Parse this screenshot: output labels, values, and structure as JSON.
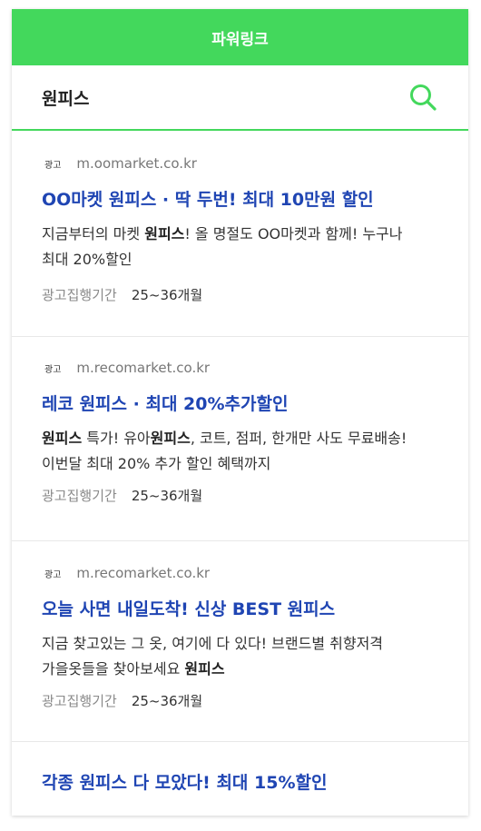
{
  "header": {
    "title": "파워링크"
  },
  "search": {
    "query": "원피스"
  },
  "ads": [
    {
      "badge": "광고",
      "url": "m.oomarket.co.kr",
      "title": "OO마켓 원피스 · 딱 두번! 최대 10만원 할인",
      "desc": [
        {
          "t": "지금부터의 마켓 ",
          "b": false
        },
        {
          "t": "원피스",
          "b": true
        },
        {
          "t": "! 올 명절도 OO마켓과 함께! 누구나 최대 20%할인",
          "b": false
        }
      ],
      "period_label": "광고집행기간",
      "period_value": "25~36개월"
    },
    {
      "badge": "광고",
      "url": "m.recomarket.co.kr",
      "title": "레코 원피스 · 최대 20%추가할인",
      "desc": [
        {
          "t": "원피스",
          "b": true
        },
        {
          "t": " 특가! 유아",
          "b": false
        },
        {
          "t": "원피스",
          "b": true
        },
        {
          "t": ", 코트, 점퍼, 한개만 사도 무료배송! 이번달 최대 20% 추가 할인 혜택까지",
          "b": false
        }
      ],
      "period_label": "광고집행기간",
      "period_value": "25~36개월"
    },
    {
      "badge": "광고",
      "url": "m.recomarket.co.kr",
      "title": "오늘 사면 내일도착! 신상 BEST 원피스",
      "desc": [
        {
          "t": "지금 찾고있는 그 옷, 여기에 다 있다! 브랜드별 취향저격 가을옷들을 찾아보세요 ",
          "b": false
        },
        {
          "t": "원피스",
          "b": true
        }
      ],
      "period_label": "광고집행기간",
      "period_value": "25~36개월"
    },
    {
      "title": "각종 원피스 다 모았다! 최대 15%할인"
    }
  ],
  "colors": {
    "accent_green": "#43d85c",
    "link_blue": "#1f45b3"
  },
  "icons": {
    "search": "search-icon"
  }
}
